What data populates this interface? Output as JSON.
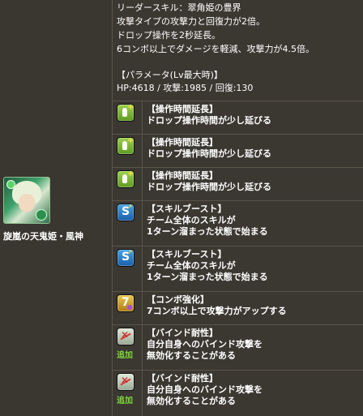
{
  "monster": {
    "name": "旋嵐の天鬼姫・風神"
  },
  "leader_skill": {
    "lines": [
      "リーダースキル：翠角姫の豊界",
      "攻撃タイプの攻撃力と回復力が2倍。",
      "ドロップ操作を2秒延長。",
      "6コンボ以上でダメージを軽減、攻撃力が4.5倍。",
      "",
      "【パラメータ(Lv最大時)】",
      "HP:4618 / 攻撃:1985 / 回復:130"
    ]
  },
  "awakenings": [
    {
      "icon": "finger-icon",
      "title": "【操作時間延長】",
      "desc": [
        "ドロップ操作時間が少し延びる"
      ],
      "extra": ""
    },
    {
      "icon": "finger-icon",
      "title": "【操作時間延長】",
      "desc": [
        "ドロップ操作時間が少し延びる"
      ],
      "extra": ""
    },
    {
      "icon": "finger-icon",
      "title": "【操作時間延長】",
      "desc": [
        "ドロップ操作時間が少し延びる"
      ],
      "extra": ""
    },
    {
      "icon": "skill-boost-icon",
      "title": "【スキルブースト】",
      "desc": [
        "チーム全体のスキルが",
        "1ターン溜まった状態で始まる"
      ],
      "extra": ""
    },
    {
      "icon": "skill-boost-icon",
      "title": "【スキルブースト】",
      "desc": [
        "チーム全体のスキルが",
        "1ターン溜まった状態で始まる"
      ],
      "extra": ""
    },
    {
      "icon": "combo-boost-icon",
      "title": "【コンボ強化】",
      "desc": [
        "7コンボ以上で攻撃力がアップする"
      ],
      "extra": ""
    },
    {
      "icon": "bind-resist-icon",
      "title": "【バインド耐性】",
      "desc": [
        "自分自身へのバインド攻撃を",
        "無効化することがある"
      ],
      "extra": "追加"
    },
    {
      "icon": "bind-resist-icon",
      "title": "【バインド耐性】",
      "desc": [
        "自分自身へのバインド攻撃を",
        "無効化することがある"
      ],
      "extra": "追加"
    }
  ]
}
